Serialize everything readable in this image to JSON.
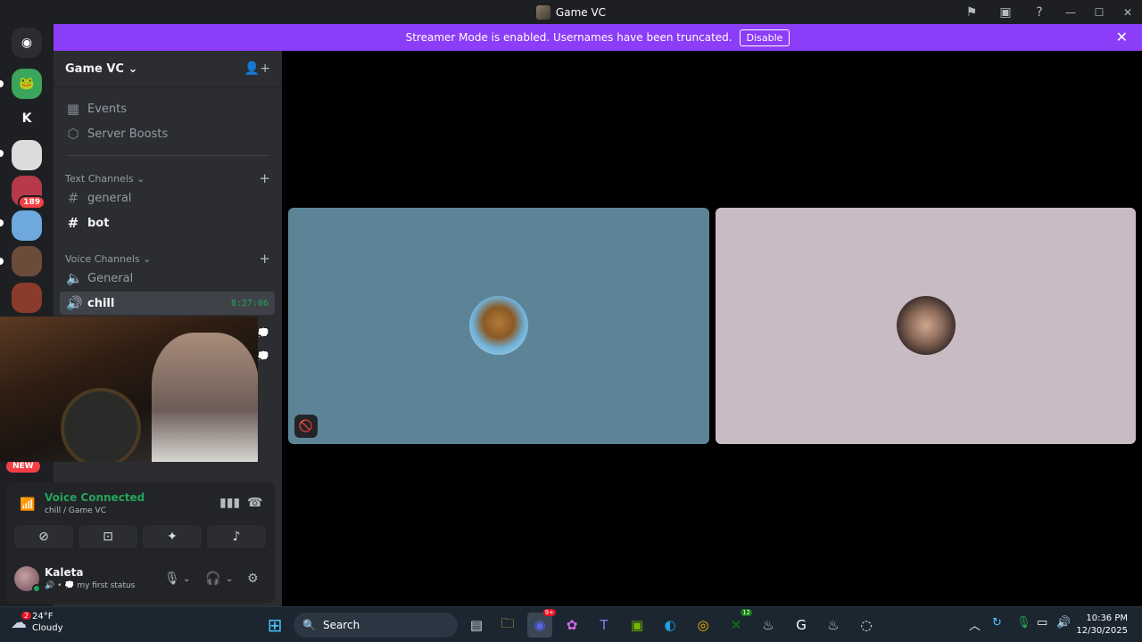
{
  "window": {
    "title": "Game VC"
  },
  "banner": {
    "text": "Streamer Mode is enabled. Usernames have been truncated.",
    "button": "Disable"
  },
  "servers": {
    "k_label": "K",
    "badge_count": "189",
    "new_label": "NEW"
  },
  "guild": {
    "name": "Game VC",
    "events": "Events",
    "boosts": "Server Boosts",
    "text_category": "Text Channels",
    "text_channels": [
      "general",
      "bot"
    ],
    "voice_category": "Voice Channels",
    "voice_channels": [
      "General",
      "chill"
    ],
    "active_timer": "8:27:06"
  },
  "voice": {
    "status": "Voice Connected",
    "location": "chill / Game VC"
  },
  "user": {
    "name": "Kaleta",
    "status": "my first status"
  },
  "taskbar": {
    "temperature": "24°F",
    "condition": "Cloudy",
    "weather_badge": "2",
    "search_placeholder": "Search",
    "discord_badge": "9+",
    "xbox_badge": "12",
    "time": "10:36 PM",
    "date": "12/30/2025"
  },
  "colors": {
    "accent": "#8c3df7",
    "connected": "#23a559",
    "tile1": "#5c8496",
    "tile2": "#c9bbc3"
  }
}
